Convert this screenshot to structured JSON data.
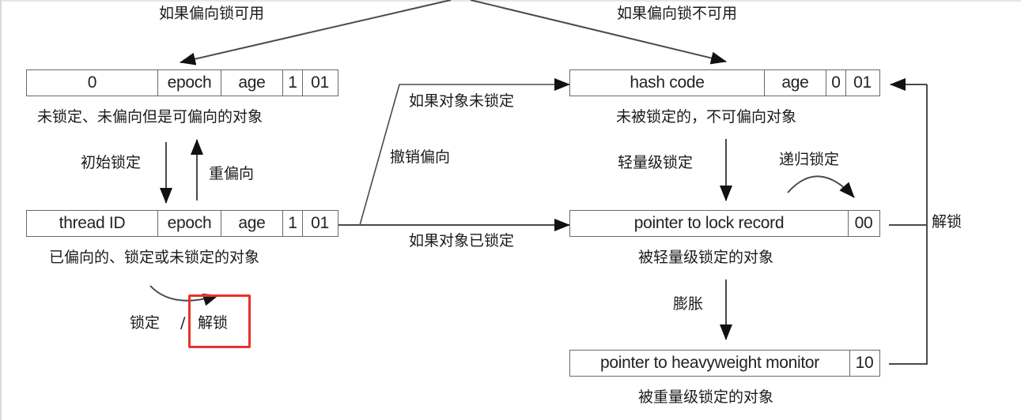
{
  "title_labels": {
    "biased_available": "如果偏向锁可用",
    "biased_unavailable": "如果偏向锁不可用"
  },
  "states": {
    "unlocked_biasable": {
      "cells": [
        "0",
        "epoch",
        "age",
        "1",
        "01"
      ],
      "caption": "未锁定、未偏向但是可偏向的对象"
    },
    "biased": {
      "cells": [
        "thread ID",
        "epoch",
        "age",
        "1",
        "01"
      ],
      "caption": "已偏向的、锁定或未锁定的对象"
    },
    "unlocked_nonbiasable": {
      "cells": [
        "hash code",
        "age",
        "0",
        "01"
      ],
      "caption": "未被锁定的，不可偏向对象"
    },
    "lightweight": {
      "cells": [
        "pointer to lock record",
        "00"
      ],
      "caption": "被轻量级锁定的对象"
    },
    "heavyweight": {
      "cells": [
        "pointer to heavyweight monitor",
        "10"
      ],
      "caption": "被重量级锁定的对象"
    }
  },
  "transitions": {
    "initial_lock": "初始锁定",
    "rebias": "重偏向",
    "revoke_bias": "撤销偏向",
    "if_object_unlocked": "如果对象未锁定",
    "if_object_locked": "如果对象已锁定",
    "lightweight_lock": "轻量级锁定",
    "recursive_lock": "递归锁定",
    "inflate": "膨胀",
    "unlock": "解锁",
    "lock": "锁定",
    "slash": "/",
    "unlock_highlighted": "解锁"
  },
  "colors": {
    "line": "#4a4a4a",
    "box_border": "#6a6a6a",
    "highlight": "#e8332a"
  }
}
